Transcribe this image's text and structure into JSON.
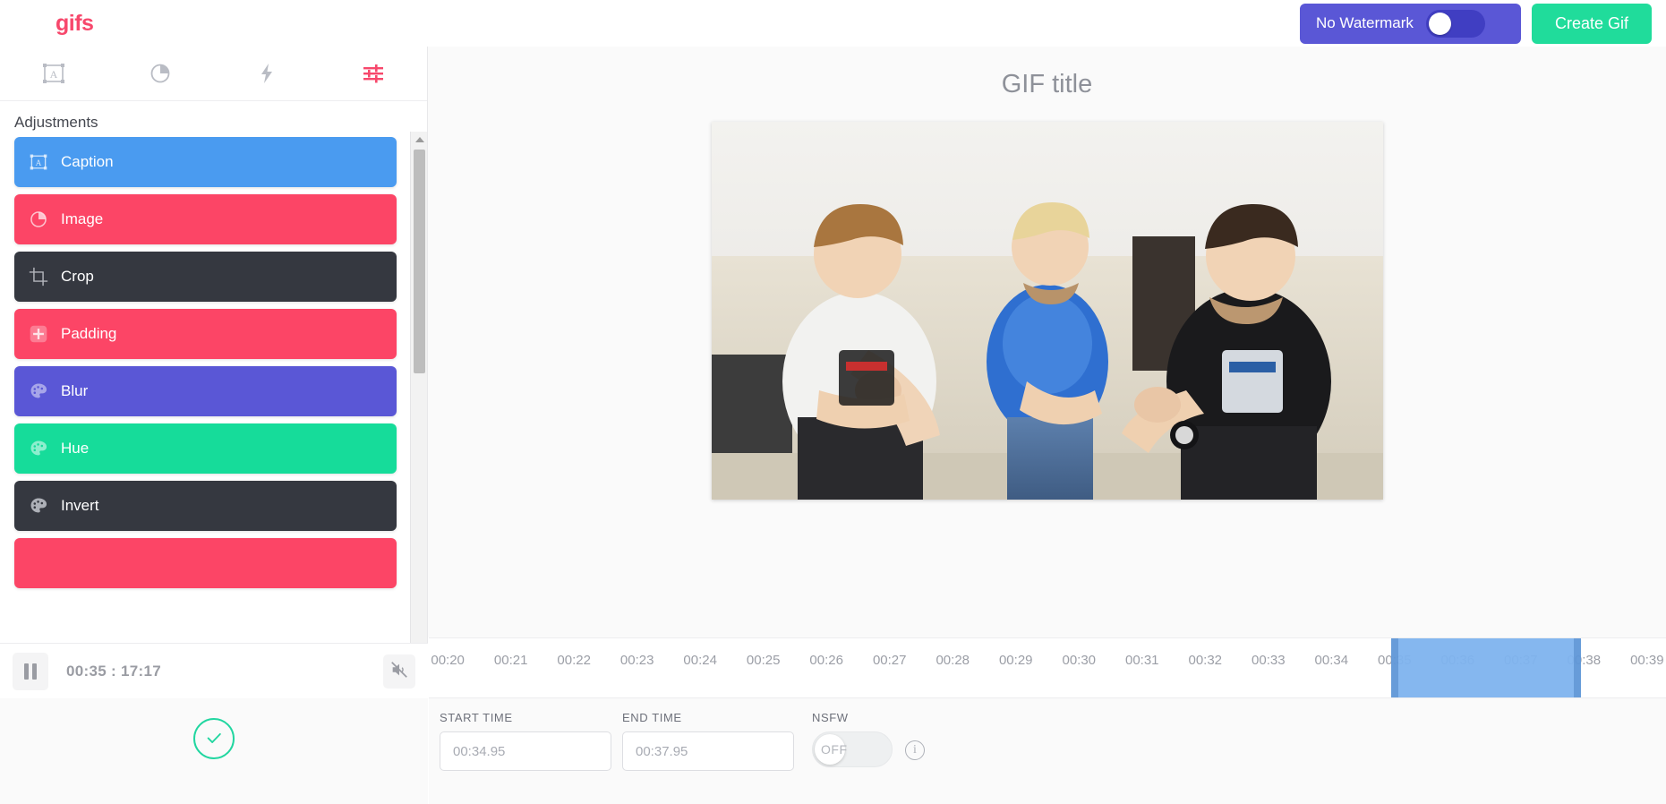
{
  "header": {
    "brand": "gifs",
    "watermark_label": "No Watermark",
    "watermark_toggle_state": "on",
    "create_button": "Create Gif",
    "brand_color": "#f7486c",
    "watermark_pill_color": "#5a57d6",
    "create_button_color": "#20dc9b"
  },
  "tabs": [
    {
      "name": "caption-tab",
      "icon": "text-frame-icon",
      "active": false
    },
    {
      "name": "image-tab",
      "icon": "palette-pie-icon",
      "active": false
    },
    {
      "name": "effects-tab",
      "icon": "lightning-bolt-icon",
      "active": false
    },
    {
      "name": "adjustments-tab",
      "icon": "sliders-icon",
      "active": true
    }
  ],
  "sidebar": {
    "title": "Adjustments",
    "items": [
      {
        "label": "Caption",
        "color": "#4a9bf0",
        "icon": "text-frame-icon"
      },
      {
        "label": "Image",
        "color": "#fc4566",
        "icon": "palette-pie-icon"
      },
      {
        "label": "Crop",
        "color": "#353840",
        "icon": "crop-icon"
      },
      {
        "label": "Padding",
        "color": "#fc4566",
        "icon": "plus-square-icon"
      },
      {
        "label": "Blur",
        "color": "#5a57d6",
        "icon": "palette-icon"
      },
      {
        "label": "Hue",
        "color": "#16dc9a",
        "icon": "palette-icon"
      },
      {
        "label": "Invert",
        "color": "#353840",
        "icon": "palette-icon"
      },
      {
        "label": "",
        "color": "#fc4566",
        "icon": "palette-icon"
      }
    ]
  },
  "player": {
    "pause_icon": "pause-icon",
    "time_readout": "00:35 : 17:17",
    "current_time": "00:35",
    "total_time": "17:17",
    "mute_icon": "mute-icon"
  },
  "confirm": {
    "icon": "check-circle-icon",
    "color": "#21d6a0"
  },
  "main": {
    "gif_title_value": "GIF title",
    "gif_title_placeholder": "GIF title"
  },
  "timeline": {
    "range_start_seconds": 19.7,
    "range_end_seconds": 39.3,
    "ticks": [
      "00:20",
      "00:21",
      "00:22",
      "00:23",
      "00:24",
      "00:25",
      "00:26",
      "00:27",
      "00:28",
      "00:29",
      "00:30",
      "00:31",
      "00:32",
      "00:33",
      "00:34",
      "00:35",
      "00:36",
      "00:37",
      "00:38",
      "00:39"
    ],
    "selection_start_seconds": 34.95,
    "selection_end_seconds": 37.95,
    "selection_color": "#7fb4ef",
    "handle_color": "#5f97d8"
  },
  "bottom_form": {
    "start_time_label": "START TIME",
    "start_time_value": "00:34.95",
    "end_time_label": "END TIME",
    "end_time_value": "00:37.95",
    "nsfw_label": "NSFW",
    "nsfw_state": "OFF",
    "info_icon": "info-icon"
  }
}
